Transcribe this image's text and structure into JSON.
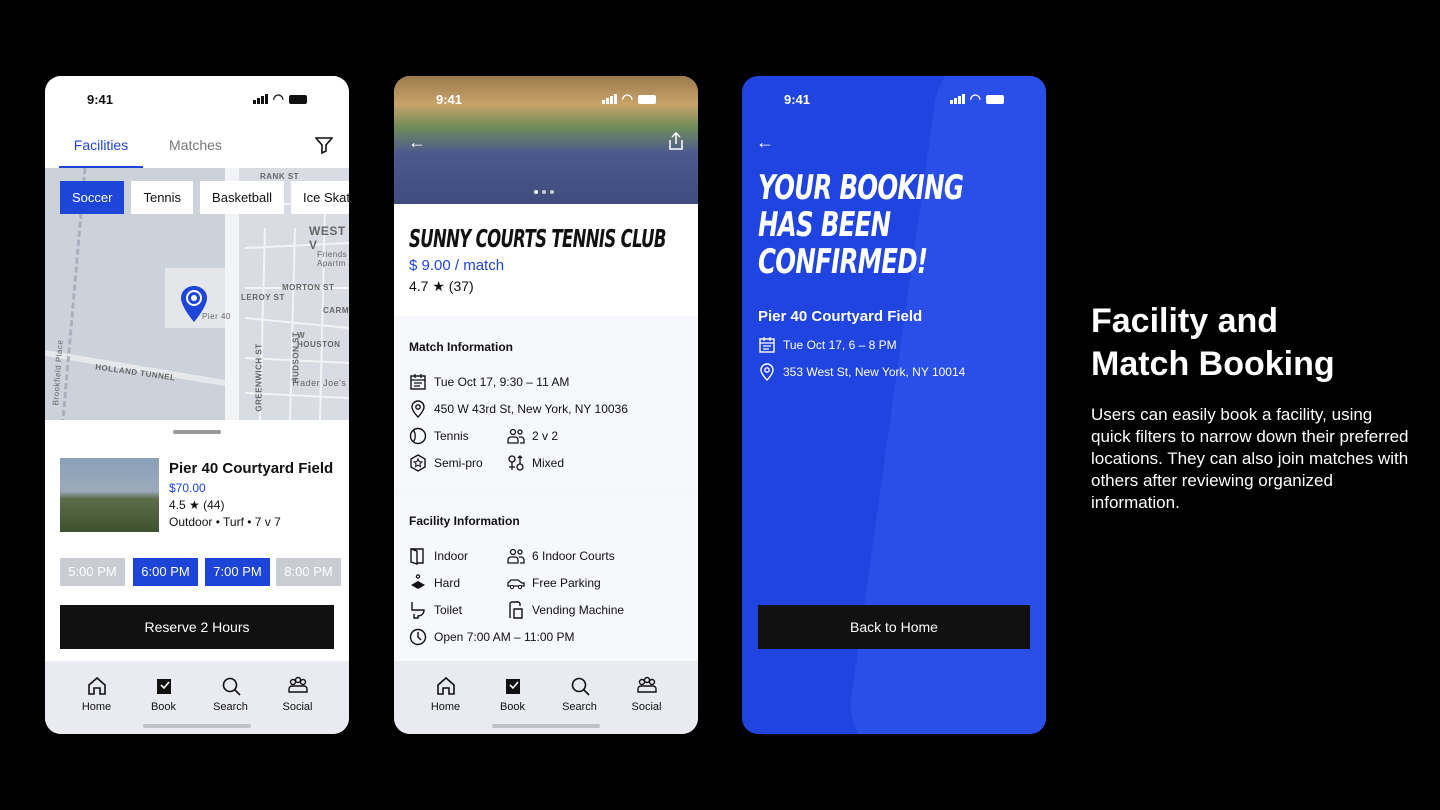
{
  "status_time": "9:41",
  "nav": [
    "Home",
    "Book",
    "Search",
    "Social"
  ],
  "screen1": {
    "tabs": [
      "Facilities",
      "Matches"
    ],
    "chips": [
      "Soccer",
      "Tennis",
      "Basketball",
      "Ice Skating"
    ],
    "map_labels": [
      "RANK ST",
      "WEST V",
      "Friends Apartm",
      "MORTON ST",
      "LEROY ST",
      "Pier 40",
      "CARMINE",
      "W HOUSTON",
      "HUDSON ST",
      "GREENWICH ST",
      "HOLLAND TUNNEL",
      "Trader Joe's",
      "Brookfield Place"
    ],
    "facility": {
      "name": "Pier 40 Courtyard Field",
      "price": "$70.00",
      "rating": "4.5 ★ (44)",
      "details": "Outdoor • Turf • 7 v 7"
    },
    "slots": [
      {
        "label": "5:00 PM",
        "available": false
      },
      {
        "label": "6:00 PM",
        "available": true
      },
      {
        "label": "7:00 PM",
        "available": true
      },
      {
        "label": "8:00 PM",
        "available": false
      }
    ],
    "reserve": "Reserve 2 Hours"
  },
  "screen2": {
    "title": "SUNNY COURTS TENNIS CLUB",
    "price": "$ 9.00 / match",
    "rating": "4.7 ★ (37)",
    "match_title": "Match Information",
    "date": "Tue Oct 17, 9:30 – 11 AM",
    "address": "450 W 43rd St, New York, NY 10036",
    "sport": "Tennis",
    "format": "2 v 2",
    "level": "Semi-pro",
    "gender": "Mixed",
    "facility_title": "Facility Information",
    "indoor": "Indoor",
    "courts": "6 Indoor Courts",
    "surface": "Hard",
    "parking": "Free Parking",
    "toilet": "Toilet",
    "vending": "Vending Machine",
    "hours": "Open 7:00 AM – 11:00 PM"
  },
  "screen3": {
    "headline": [
      "YOUR BOOKING",
      "HAS BEEN",
      "CONFIRMED!"
    ],
    "facility": "Pier 40 Courtyard Field",
    "date": "Tue Oct 17, 6 – 8 PM",
    "address": "353 West St, New York, NY 10014",
    "button": "Back to Home"
  },
  "caption": {
    "title_lines": [
      "Facility and",
      "Match Booking"
    ],
    "body": "Users can easily book a facility, using quick filters to narrow down their preferred locations. They can also join matches with others after reviewing organized information."
  },
  "colors": {
    "accent": "#1d45d8",
    "confirm_bg": "#1f44e0",
    "dark": "#111111"
  }
}
